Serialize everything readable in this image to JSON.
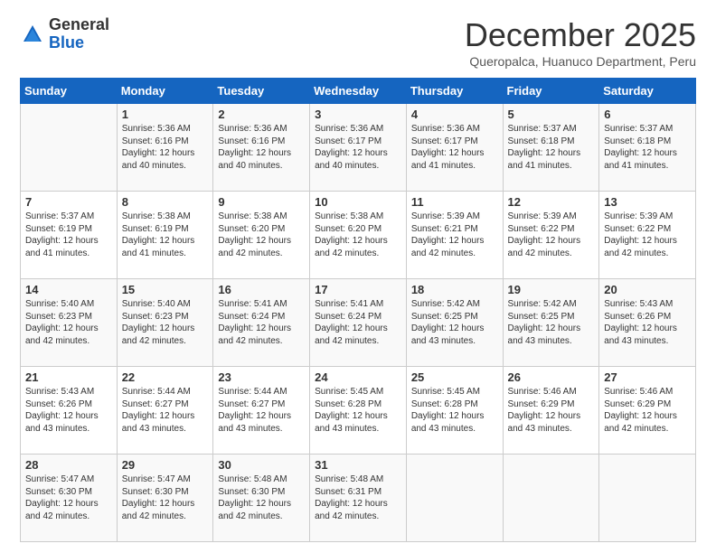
{
  "header": {
    "logo_general": "General",
    "logo_blue": "Blue",
    "month_title": "December 2025",
    "subtitle": "Queropalca, Huanuco Department, Peru"
  },
  "days_of_week": [
    "Sunday",
    "Monday",
    "Tuesday",
    "Wednesday",
    "Thursday",
    "Friday",
    "Saturday"
  ],
  "weeks": [
    [
      {
        "day": "",
        "info": ""
      },
      {
        "day": "1",
        "info": "Sunrise: 5:36 AM\nSunset: 6:16 PM\nDaylight: 12 hours and 40 minutes."
      },
      {
        "day": "2",
        "info": "Sunrise: 5:36 AM\nSunset: 6:16 PM\nDaylight: 12 hours and 40 minutes."
      },
      {
        "day": "3",
        "info": "Sunrise: 5:36 AM\nSunset: 6:17 PM\nDaylight: 12 hours and 40 minutes."
      },
      {
        "day": "4",
        "info": "Sunrise: 5:36 AM\nSunset: 6:17 PM\nDaylight: 12 hours and 41 minutes."
      },
      {
        "day": "5",
        "info": "Sunrise: 5:37 AM\nSunset: 6:18 PM\nDaylight: 12 hours and 41 minutes."
      },
      {
        "day": "6",
        "info": "Sunrise: 5:37 AM\nSunset: 6:18 PM\nDaylight: 12 hours and 41 minutes."
      }
    ],
    [
      {
        "day": "7",
        "info": "Sunrise: 5:37 AM\nSunset: 6:19 PM\nDaylight: 12 hours and 41 minutes."
      },
      {
        "day": "8",
        "info": "Sunrise: 5:38 AM\nSunset: 6:19 PM\nDaylight: 12 hours and 41 minutes."
      },
      {
        "day": "9",
        "info": "Sunrise: 5:38 AM\nSunset: 6:20 PM\nDaylight: 12 hours and 42 minutes."
      },
      {
        "day": "10",
        "info": "Sunrise: 5:38 AM\nSunset: 6:20 PM\nDaylight: 12 hours and 42 minutes."
      },
      {
        "day": "11",
        "info": "Sunrise: 5:39 AM\nSunset: 6:21 PM\nDaylight: 12 hours and 42 minutes."
      },
      {
        "day": "12",
        "info": "Sunrise: 5:39 AM\nSunset: 6:22 PM\nDaylight: 12 hours and 42 minutes."
      },
      {
        "day": "13",
        "info": "Sunrise: 5:39 AM\nSunset: 6:22 PM\nDaylight: 12 hours and 42 minutes."
      }
    ],
    [
      {
        "day": "14",
        "info": "Sunrise: 5:40 AM\nSunset: 6:23 PM\nDaylight: 12 hours and 42 minutes."
      },
      {
        "day": "15",
        "info": "Sunrise: 5:40 AM\nSunset: 6:23 PM\nDaylight: 12 hours and 42 minutes."
      },
      {
        "day": "16",
        "info": "Sunrise: 5:41 AM\nSunset: 6:24 PM\nDaylight: 12 hours and 42 minutes."
      },
      {
        "day": "17",
        "info": "Sunrise: 5:41 AM\nSunset: 6:24 PM\nDaylight: 12 hours and 42 minutes."
      },
      {
        "day": "18",
        "info": "Sunrise: 5:42 AM\nSunset: 6:25 PM\nDaylight: 12 hours and 43 minutes."
      },
      {
        "day": "19",
        "info": "Sunrise: 5:42 AM\nSunset: 6:25 PM\nDaylight: 12 hours and 43 minutes."
      },
      {
        "day": "20",
        "info": "Sunrise: 5:43 AM\nSunset: 6:26 PM\nDaylight: 12 hours and 43 minutes."
      }
    ],
    [
      {
        "day": "21",
        "info": "Sunrise: 5:43 AM\nSunset: 6:26 PM\nDaylight: 12 hours and 43 minutes."
      },
      {
        "day": "22",
        "info": "Sunrise: 5:44 AM\nSunset: 6:27 PM\nDaylight: 12 hours and 43 minutes."
      },
      {
        "day": "23",
        "info": "Sunrise: 5:44 AM\nSunset: 6:27 PM\nDaylight: 12 hours and 43 minutes."
      },
      {
        "day": "24",
        "info": "Sunrise: 5:45 AM\nSunset: 6:28 PM\nDaylight: 12 hours and 43 minutes."
      },
      {
        "day": "25",
        "info": "Sunrise: 5:45 AM\nSunset: 6:28 PM\nDaylight: 12 hours and 43 minutes."
      },
      {
        "day": "26",
        "info": "Sunrise: 5:46 AM\nSunset: 6:29 PM\nDaylight: 12 hours and 43 minutes."
      },
      {
        "day": "27",
        "info": "Sunrise: 5:46 AM\nSunset: 6:29 PM\nDaylight: 12 hours and 42 minutes."
      }
    ],
    [
      {
        "day": "28",
        "info": "Sunrise: 5:47 AM\nSunset: 6:30 PM\nDaylight: 12 hours and 42 minutes."
      },
      {
        "day": "29",
        "info": "Sunrise: 5:47 AM\nSunset: 6:30 PM\nDaylight: 12 hours and 42 minutes."
      },
      {
        "day": "30",
        "info": "Sunrise: 5:48 AM\nSunset: 6:30 PM\nDaylight: 12 hours and 42 minutes."
      },
      {
        "day": "31",
        "info": "Sunrise: 5:48 AM\nSunset: 6:31 PM\nDaylight: 12 hours and 42 minutes."
      },
      {
        "day": "",
        "info": ""
      },
      {
        "day": "",
        "info": ""
      },
      {
        "day": "",
        "info": ""
      }
    ]
  ]
}
